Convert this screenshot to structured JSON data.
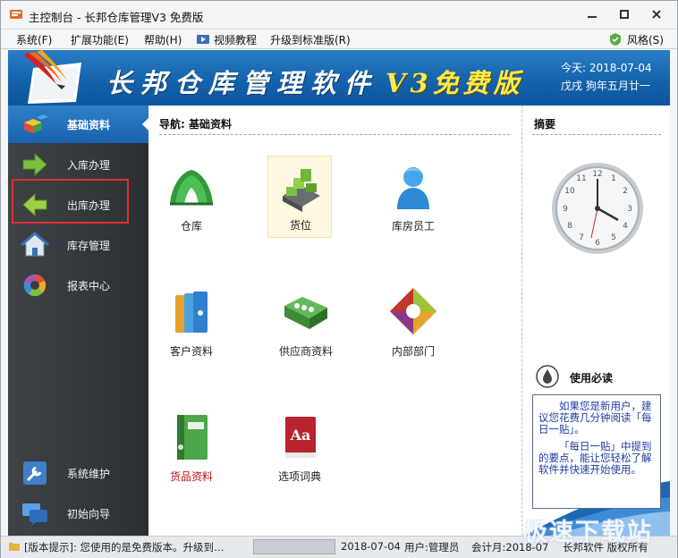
{
  "window": {
    "title": "主控制台 - 长邦仓库管理V3 免费版"
  },
  "menu": {
    "items": [
      "系统(F)",
      "扩展功能(E)",
      "帮助(H)",
      "视频教程",
      "升级到标准版(R)"
    ],
    "skin": "风格(S)"
  },
  "banner": {
    "title": "长邦仓库管理软件",
    "version": "V3免费版",
    "date_line1": "今天: 2018-07-04",
    "date_line2": "戊戌 狗年五月廿一"
  },
  "sidebar": {
    "items": [
      {
        "label": "基础资料",
        "icon": "blocks-icon"
      },
      {
        "label": "入库办理",
        "icon": "arrow-right-icon"
      },
      {
        "label": "出库办理",
        "icon": "arrow-left-icon"
      },
      {
        "label": "库存管理",
        "icon": "house-icon"
      },
      {
        "label": "报表中心",
        "icon": "color-wheel-icon"
      },
      {
        "label": "系统维护",
        "icon": "wrench-icon"
      },
      {
        "label": "初始向导",
        "icon": "chat-icon"
      }
    ],
    "active": "基础资料",
    "highlighted": "出库办理"
  },
  "main": {
    "nav_title": "导航: 基础资料",
    "tiles": [
      {
        "label": "仓库",
        "icon": "tent-icon"
      },
      {
        "label": "货位",
        "icon": "shelf-icon"
      },
      {
        "label": "库房员工",
        "icon": "person-icon"
      },
      {
        "label": "客户资料",
        "icon": "binders-icon"
      },
      {
        "label": "供应商资料",
        "icon": "supplier-folder-icon"
      },
      {
        "label": "内部部门",
        "icon": "department-icon"
      },
      {
        "label": "货品资料",
        "icon": "green-binder-icon"
      },
      {
        "label": "选项词典",
        "icon": "dictionary-icon"
      }
    ]
  },
  "right_panel": {
    "title": "摘要",
    "clock_numbers": [
      "12",
      "1",
      "2",
      "3",
      "4",
      "5",
      "6",
      "7",
      "8",
      "9",
      "10",
      "11"
    ],
    "notice_title": "使用必读",
    "notice_p1": "如果您是新用户，建议您花费几分钟阅读「每日一贴」。",
    "notice_p2": "「每日一贴」中提到的要点，能让您轻松了解软件并快速开始使用。"
  },
  "status": {
    "hint": "[版本提示]: 您使用的是免费版本。升级到…",
    "date": "2018-07-04",
    "user": "用户:管理员",
    "period": "会计月:2018-07",
    "copyright": "长邦软件 版权所有"
  },
  "watermark": "极速下载站",
  "colors": {
    "accent": "#1a62ad",
    "sidebar_bg": "#35383c",
    "highlight_box": "#e02f2f",
    "banner_version": "#ffe94a"
  }
}
